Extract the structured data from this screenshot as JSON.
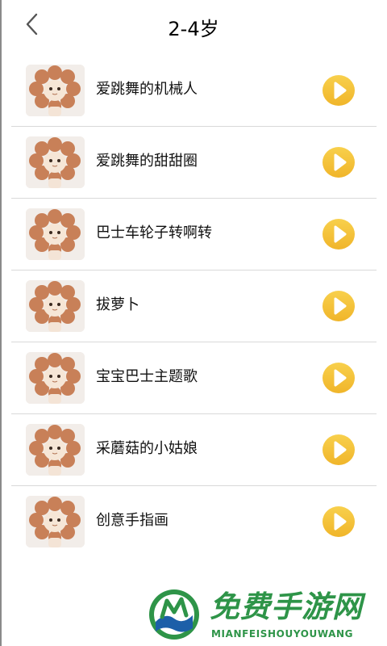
{
  "header": {
    "title": "2-4岁",
    "back_icon": "chevron-left-icon"
  },
  "songs": [
    {
      "title": "爱跳舞的机械人",
      "thumbnail": "cat-flower-hat-image",
      "action_icon": "play-icon"
    },
    {
      "title": "爱跳舞的甜甜圈",
      "thumbnail": "cat-flower-hat-image",
      "action_icon": "play-icon"
    },
    {
      "title": "巴士车轮子转啊转",
      "thumbnail": "cat-flower-hat-image",
      "action_icon": "play-icon"
    },
    {
      "title": "拔萝卜",
      "thumbnail": "cat-flower-hat-image",
      "action_icon": "play-icon"
    },
    {
      "title": "宝宝巴士主题歌",
      "thumbnail": "cat-flower-hat-image",
      "action_icon": "play-icon"
    },
    {
      "title": "采蘑菇的小姑娘",
      "thumbnail": "cat-flower-hat-image",
      "action_icon": "play-icon"
    },
    {
      "title": "创意手指画",
      "thumbnail": "cat-flower-hat-image",
      "action_icon": "play-icon"
    }
  ],
  "watermark": {
    "title": "免费手游网",
    "subtitle": "MIANFEISHOUYOUWANG"
  },
  "colors": {
    "play_button": "#f4c431",
    "divider": "#d9d9d9",
    "watermark_green": "#2e9448"
  }
}
